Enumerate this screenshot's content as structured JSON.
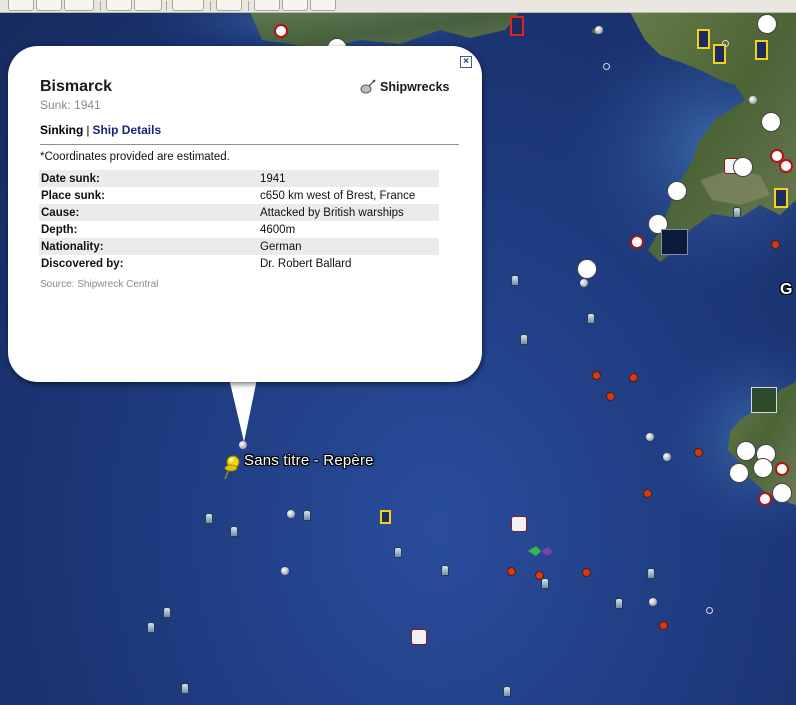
{
  "map": {
    "pushpin_label": "Sans titre - Repère",
    "edge_label": "G"
  },
  "balloon": {
    "title": "Bismarck",
    "subtitle": "Sunk: 1941",
    "layer_name": "Shipwrecks",
    "close_symbol": "×",
    "tabs": {
      "active": "Sinking",
      "separator": "|",
      "link": "Ship Details"
    },
    "note": "*Coordinates provided are estimated.",
    "details": [
      {
        "label": "Date sunk:",
        "value": "1941"
      },
      {
        "label": "Place sunk:",
        "value": "c650 km west of Brest, France"
      },
      {
        "label": "Cause:",
        "value": "Attacked by British warships"
      },
      {
        "label": "Depth:",
        "value": "4600m"
      },
      {
        "label": "Nationality:",
        "value": "German"
      },
      {
        "label": "Discovered by:",
        "value": "Dr. Robert Ballard"
      }
    ],
    "source": "Source: Shipwreck Central"
  },
  "icons": [
    "shipwreck-icon",
    "pushpin-icon",
    "buoy-icon",
    "youtube-icon",
    "webcam-icon",
    "panorama-360-icon",
    "hiker-icon",
    "cyclist-icon",
    "photo-frame-icon",
    "close-icon"
  ],
  "colors": {
    "ocean": "#213f86",
    "land": "#4f6b3c",
    "pin": "#f2d60d",
    "accent_link": "#1a237e"
  }
}
